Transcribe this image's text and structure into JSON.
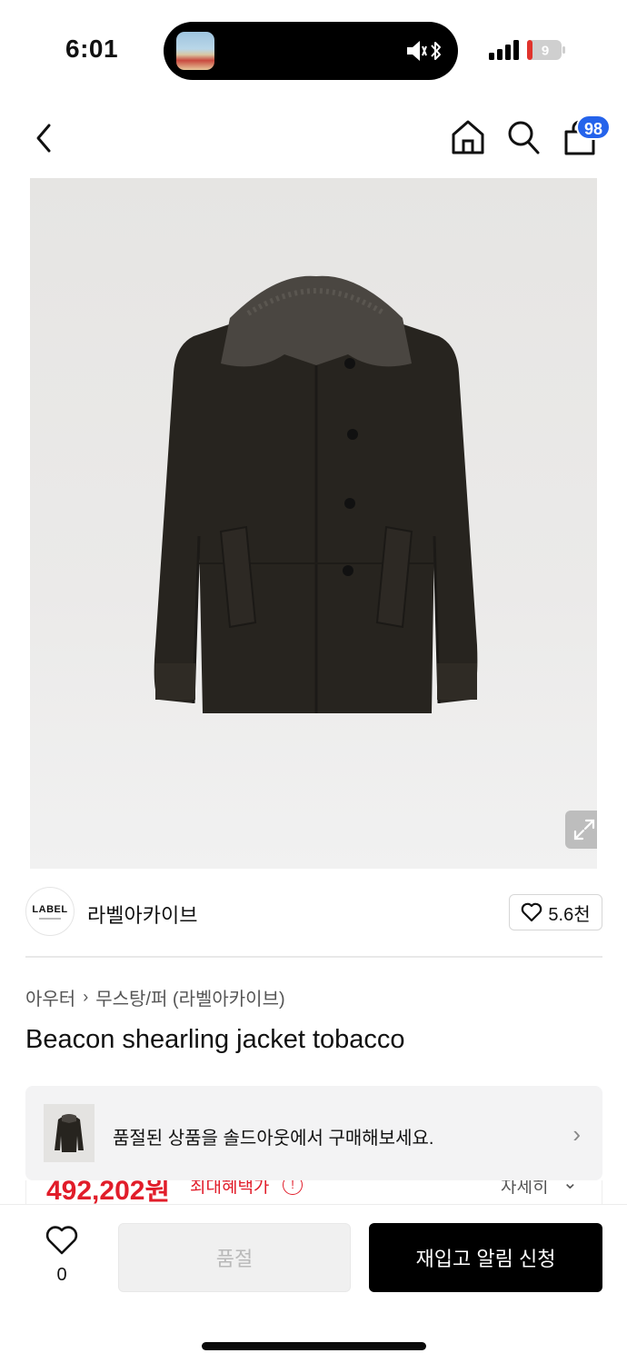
{
  "status_bar": {
    "time": "6:01",
    "battery_level": "9"
  },
  "header": {
    "cart_count": "98"
  },
  "brand": {
    "logo_text": "LABEL",
    "name": "라벨아카이브",
    "like_count": "5.6천"
  },
  "breadcrumb": {
    "category": "아우터",
    "subcategory": "무스탕/퍼 (라벨아카이브)"
  },
  "product": {
    "title": "Beacon shearling jacket tobacco"
  },
  "soldout_banner": {
    "text": "품절된 상품을 솔드아웃에서 구매해보세요."
  },
  "price": {
    "amount": "492,202원",
    "label": "최대혜택가",
    "detail_label": "자세히"
  },
  "action_bar": {
    "wish_count": "0",
    "soldout_label": "품절",
    "restock_label": "재입고 알림 신청"
  },
  "colors": {
    "accent_blue": "#2563eb",
    "price_red": "#e11d2a",
    "primary_button": "#000000"
  }
}
